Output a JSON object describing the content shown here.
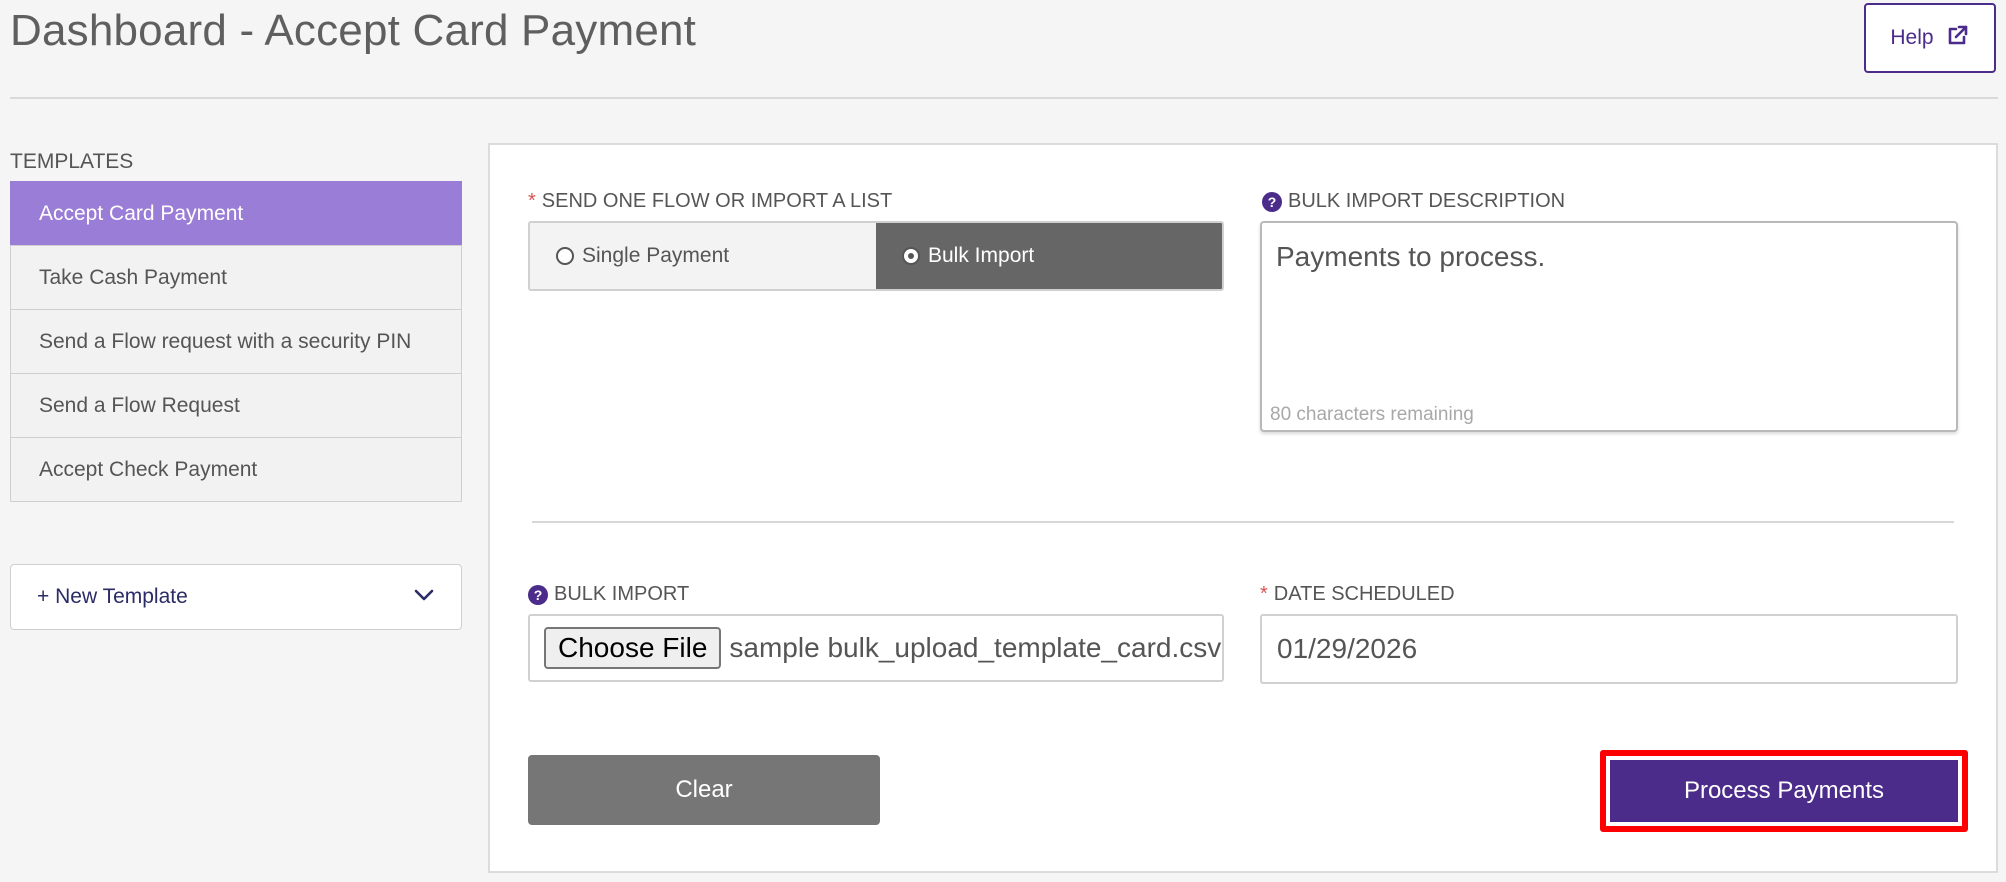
{
  "header": {
    "title": "Dashboard - Accept Card Payment",
    "help_label": "Help",
    "help_icon": "external-link-icon"
  },
  "sidebar": {
    "templates_heading": "TEMPLATES",
    "items": [
      {
        "label": "Accept Card Payment",
        "active": true
      },
      {
        "label": "Take Cash Payment",
        "active": false
      },
      {
        "label": "Send a Flow request with a security PIN",
        "active": false
      },
      {
        "label": "Send a Flow Request",
        "active": false
      },
      {
        "label": "Accept Check Payment",
        "active": false
      }
    ],
    "new_template_label": "+ New Template",
    "new_template_icon": "chevron-down-icon"
  },
  "form": {
    "mode_label": "SEND ONE FLOW OR IMPORT A LIST",
    "mode_options": [
      {
        "label": "Single Payment",
        "selected": false
      },
      {
        "label": "Bulk Import",
        "selected": true
      }
    ],
    "description_label": "BULK IMPORT DESCRIPTION",
    "description_value": "Payments to process.",
    "description_remaining": "80 characters remaining",
    "bulk_import_label": "BULK IMPORT",
    "choose_file_label": "Choose File",
    "file_name": "sample bulk_upload_template_card.csv",
    "date_label": "DATE SCHEDULED",
    "date_value": "01/29/2026",
    "clear_label": "Clear",
    "process_label": "Process Payments"
  },
  "colors": {
    "brand_purple": "#4b2c8a",
    "active_template": "#9a7dd6",
    "required_asterisk": "#d9534f",
    "highlight_outline": "#ff0000",
    "clear_button": "#767676"
  }
}
